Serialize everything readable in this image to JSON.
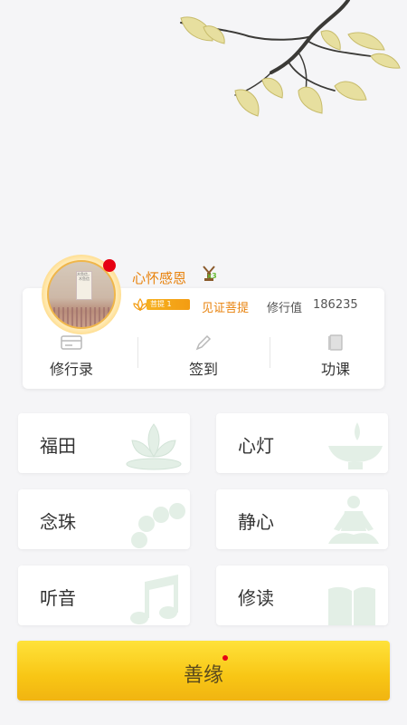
{
  "profile": {
    "username": "心怀感恩",
    "cup_count": "x3",
    "level_badge": "菩提 1",
    "witness_link": "见证菩提",
    "merit_label": "修行值",
    "merit_value": "186235",
    "avatar_scroll_text": "木鱼信，木鱼信"
  },
  "actions": [
    {
      "label": "修行录",
      "icon": "card-icon"
    },
    {
      "label": "签到",
      "icon": "pencil-icon"
    },
    {
      "label": "功课",
      "icon": "book-icon"
    }
  ],
  "tiles": [
    {
      "label": "福田",
      "icon": "lotus-icon"
    },
    {
      "label": "心灯",
      "icon": "oil-lamp-icon"
    },
    {
      "label": "念珠",
      "icon": "prayer-beads-icon"
    },
    {
      "label": "静心",
      "icon": "meditation-icon"
    },
    {
      "label": "听音",
      "icon": "music-note-icon"
    },
    {
      "label": "修读",
      "icon": "open-book-icon"
    }
  ],
  "bottom_button": {
    "label": "善缘"
  },
  "colors": {
    "accent_orange": "#e8820c",
    "button_yellow": "#f8c615",
    "notify_red": "#e60012",
    "background": "#f5f5f7"
  }
}
